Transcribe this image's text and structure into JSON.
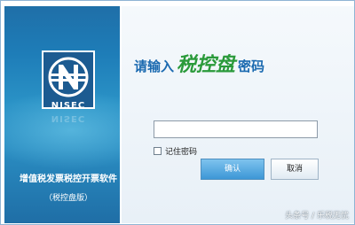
{
  "brand": {
    "logo_text": "NISEC",
    "product_name": "增值税发票税控开票软件",
    "edition": "（税控盘版）"
  },
  "login": {
    "prompt_prefix": "请输入",
    "prompt_highlight": "税控盘",
    "prompt_suffix": "密码",
    "password_value": "",
    "remember_label": "记住密码",
    "remember_checked": false,
    "ok_label": "确认",
    "cancel_label": "取消"
  },
  "watermark": "头条号 / 乐税无忧",
  "colors": {
    "panel_blue": "#1e7db8",
    "prompt_blue": "#1b6ab0",
    "highlight_green": "#2a9a3a",
    "ok_button": "#3d97d6"
  }
}
